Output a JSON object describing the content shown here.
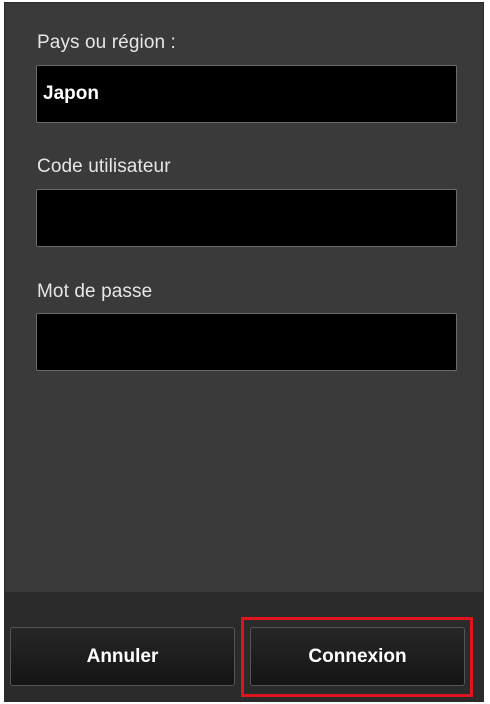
{
  "form": {
    "country": {
      "label": "Pays ou région :",
      "value": "Japon"
    },
    "user_id": {
      "label": "Code utilisateur",
      "value": ""
    },
    "password": {
      "label": "Mot de passe",
      "value": ""
    }
  },
  "footer": {
    "cancel_label": "Annuler",
    "login_label": "Connexion",
    "highlight_color": "#e0141e"
  }
}
